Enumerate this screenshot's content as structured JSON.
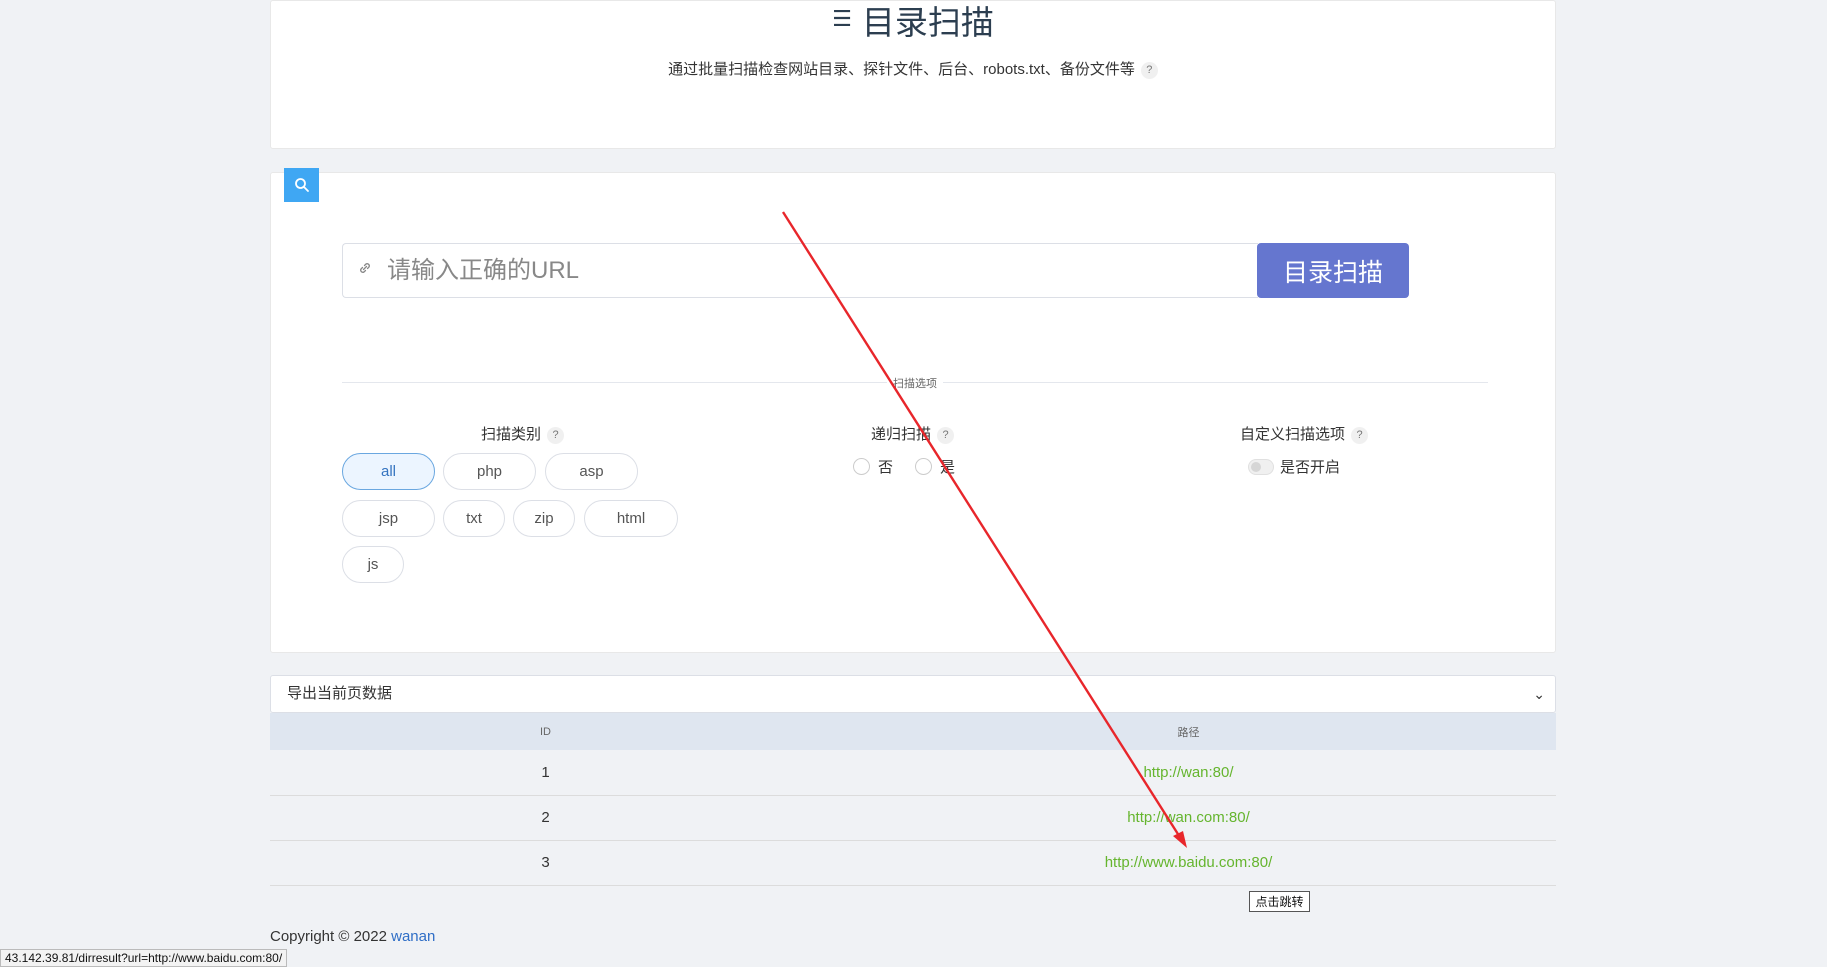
{
  "header": {
    "title": "目录扫描",
    "subtitle": "通过批量扫描检查网站目录、探针文件、后台、robots.txt、备份文件等",
    "help": "?"
  },
  "scan": {
    "url_placeholder": "请输入正确的URL",
    "button_label": "目录扫描",
    "divider_label": "扫描选项",
    "type_label": "扫描类别",
    "recursive_label": "递归扫描",
    "custom_label": "自定义扫描选项",
    "types": [
      "all",
      "php",
      "asp",
      "jsp",
      "txt",
      "zip",
      "html",
      "js"
    ],
    "selected_type": "all",
    "radio_no": "否",
    "radio_yes": "是",
    "switch_label": "是否开启"
  },
  "export": {
    "label": "导出当前页数据"
  },
  "table": {
    "headers": [
      "ID",
      "路径"
    ],
    "rows": [
      {
        "id": "1",
        "path": "http://wan:80/"
      },
      {
        "id": "2",
        "path": "http://wan.com:80/"
      },
      {
        "id": "3",
        "path": "http://www.baidu.com:80/"
      }
    ]
  },
  "jump_button": "点击跳转",
  "footer": {
    "copyright": "Copyright © 2022",
    "author": "wanan"
  },
  "status_url": "43.142.39.81/dirresult?url=http://www.baidu.com:80/",
  "colors": {
    "primary": "#6576cf",
    "badge": "#3fa7f3",
    "link": "#65b52e",
    "annotation_arrow": "#e8262b"
  }
}
